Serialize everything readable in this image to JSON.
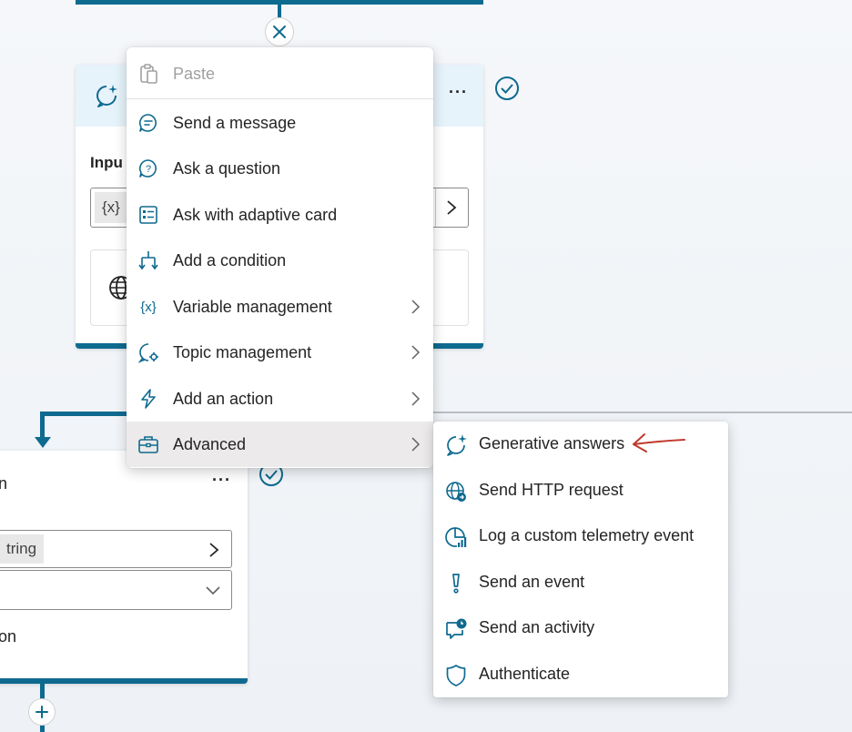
{
  "context_menu": {
    "items": [
      {
        "label": "Paste",
        "icon": "paste-icon",
        "disabled": true,
        "submenu": false
      },
      {
        "label": "Send a message",
        "icon": "message-icon",
        "disabled": false,
        "submenu": false
      },
      {
        "label": "Ask a question",
        "icon": "question-icon",
        "disabled": false,
        "submenu": false
      },
      {
        "label": "Ask with adaptive card",
        "icon": "adaptive-card-icon",
        "disabled": false,
        "submenu": false
      },
      {
        "label": "Add a condition",
        "icon": "condition-icon",
        "disabled": false,
        "submenu": false
      },
      {
        "label": "Variable management",
        "icon": "variable-icon",
        "disabled": false,
        "submenu": true
      },
      {
        "label": "Topic management",
        "icon": "topic-icon",
        "disabled": false,
        "submenu": true
      },
      {
        "label": "Add an action",
        "icon": "action-icon",
        "disabled": false,
        "submenu": true
      },
      {
        "label": "Advanced",
        "icon": "toolbox-icon",
        "disabled": false,
        "submenu": true,
        "highlighted": true
      }
    ]
  },
  "advanced_submenu": {
    "items": [
      {
        "label": "Generative answers",
        "icon": "generative-answers-icon"
      },
      {
        "label": "Send HTTP request",
        "icon": "http-request-icon"
      },
      {
        "label": "Log a custom telemetry event",
        "icon": "telemetry-icon"
      },
      {
        "label": "Send an event",
        "icon": "event-icon"
      },
      {
        "label": "Send an activity",
        "icon": "activity-icon"
      },
      {
        "label": "Authenticate",
        "icon": "shield-icon"
      }
    ]
  },
  "top_node": {
    "input_label_fragment": "Inpu",
    "variable_chip_fragment": "{x}"
  },
  "lower_node": {
    "title_fragment": "n",
    "chip_fragment": "tring",
    "text_fragment": "on"
  },
  "colors": {
    "accent": "#0f6a8f",
    "menu_highlight": "#eceaea",
    "annotation_arrow": "#c0392b"
  }
}
